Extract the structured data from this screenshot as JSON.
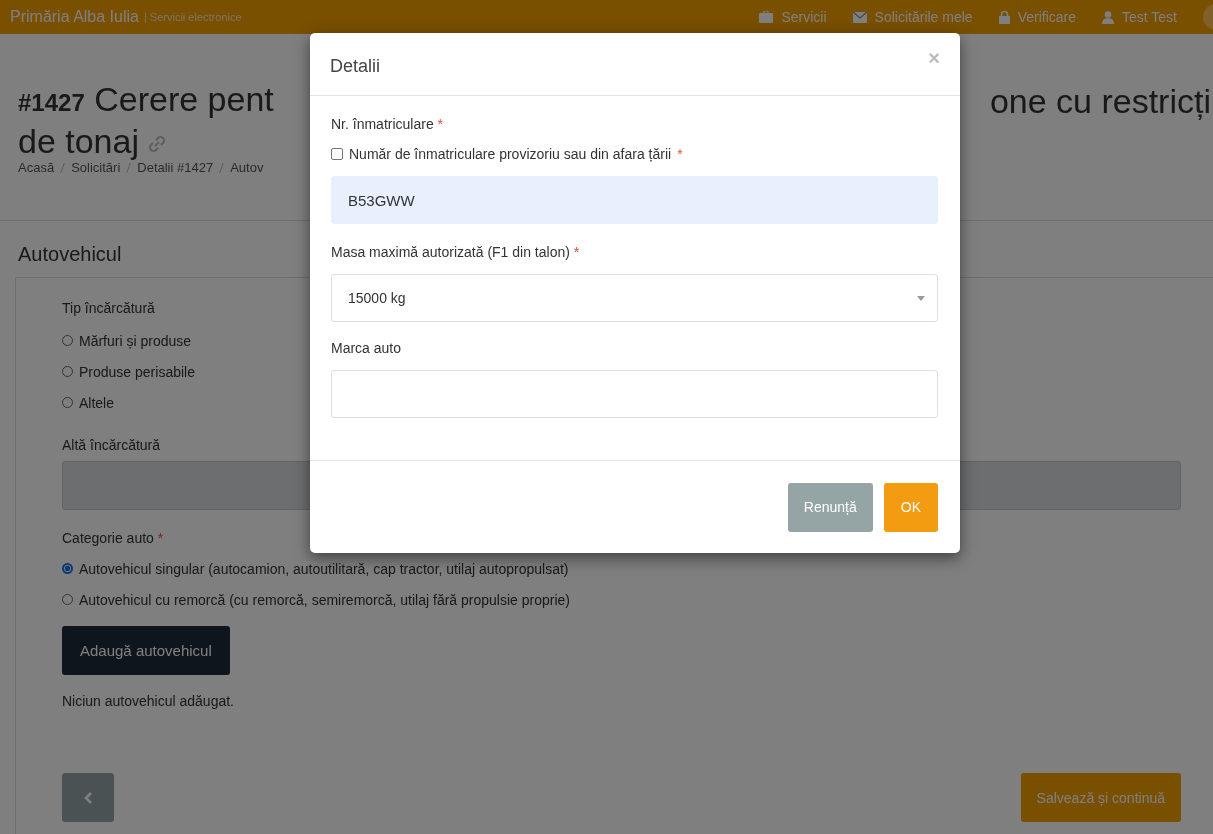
{
  "header": {
    "brand": "Primăria Alba Iulia",
    "subtitle": "| Servicii electronice",
    "nav": [
      {
        "kind": "briefcase",
        "label": "Servicii"
      },
      {
        "kind": "envelope",
        "label": "Solicitările mele"
      },
      {
        "kind": "lock",
        "label": "Verificare"
      },
      {
        "kind": "user",
        "label": "Test Test"
      }
    ]
  },
  "title": {
    "number": "#1427",
    "left": "Cerere pent",
    "right": "one cu restricți",
    "line2": "de tonaj"
  },
  "breadcrumb": [
    "Acasă",
    "Solicitări",
    "Detalii #1427",
    "Autov"
  ],
  "section": "Autovehicul",
  "form": {
    "load_type": {
      "label": "Tip încărcătură",
      "options": [
        {
          "label": "Mărfuri și produse",
          "selected": false
        },
        {
          "label": "Produse perisabile",
          "selected": false
        },
        {
          "label": "Altele",
          "selected": false
        }
      ]
    },
    "other_load": {
      "label": "Altă încărcătură",
      "disabled": true
    },
    "category": {
      "label": "Categorie auto",
      "required": "*",
      "options": [
        {
          "label": "Autovehicul singular (autocamion, autoutilitară, cap tractor, utilaj autopropulsat)",
          "selected": true
        },
        {
          "label": "Autovehicul cu remorcă (cu remorcă, semiremorcă, utilaj fără propulsie proprie)",
          "selected": false
        }
      ]
    },
    "add_button": "Adaugă autovehicul",
    "empty_note": "Niciun autovehicul adăugat.",
    "save_button": "Salvează și continuă"
  },
  "modal": {
    "title": "Detalii",
    "close": "×",
    "plate_label": "Nr. înmatriculare",
    "plate_required": "*",
    "temp_plate": {
      "label": "Număr de înmatriculare provizoriu sau din afara țării",
      "required": "*",
      "checked": false
    },
    "plate_value": "B53GWW",
    "mass_label": "Masa maximă autorizată (F1 din talon)",
    "mass_required": "*",
    "mass_value": "15000 kg",
    "brand_label": "Marca auto",
    "cancel": "Renunță",
    "ok": "OK"
  }
}
